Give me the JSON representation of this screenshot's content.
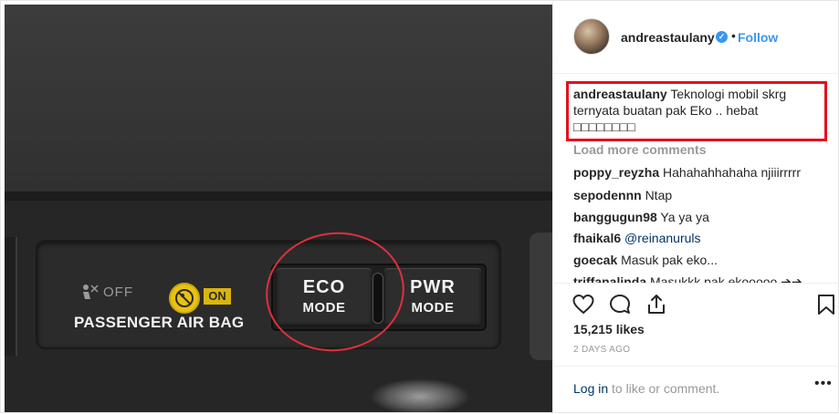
{
  "photo": {
    "sticker_off": "OFF",
    "sticker_on": "ON",
    "passenger_label": "PASSENGER AIR BAG",
    "eco_line1": "ECO",
    "eco_line2": "MODE",
    "pwr_line1": "PWR",
    "pwr_line2": "MODE",
    "annotation_color": "#e0303a"
  },
  "header": {
    "username": "andreastaulany",
    "verified_icon": "verified-badge-icon",
    "separator": "•",
    "follow_label": "Follow"
  },
  "caption": {
    "author": "andreastaulany",
    "text": "Teknologi mobil skrg ternyata buatan pak Eko .. hebat □□□□□□□□",
    "highlight_color": "#e4111c"
  },
  "load_more": "Load more comments",
  "comments": [
    {
      "user": "poppy_reyzha",
      "text": "Hahahahhahaha njiiirrrrr"
    },
    {
      "user": "sepodennn",
      "text": "Ntap"
    },
    {
      "user": "banggugun98",
      "text": "Ya ya ya"
    },
    {
      "user": "fhaikal6",
      "text": "@reinanuruls"
    },
    {
      "user": "goecak",
      "text": "Masuk pak eko..."
    },
    {
      "user": "triffanalinda",
      "text": "Masukkk pak ekooooo ➔➔"
    }
  ],
  "actions": {
    "like_icon": "heart-icon",
    "comment_icon": "comment-icon",
    "share_icon": "share-icon",
    "save_icon": "bookmark-icon"
  },
  "likes": "15,215 likes",
  "date": "2 DAYS AGO",
  "footer": {
    "login_link": "Log in",
    "login_rest": " to like or comment.",
    "more_label": "•••"
  },
  "colors": {
    "accent": "#3897f0",
    "link": "#003569",
    "muted": "#999999"
  }
}
